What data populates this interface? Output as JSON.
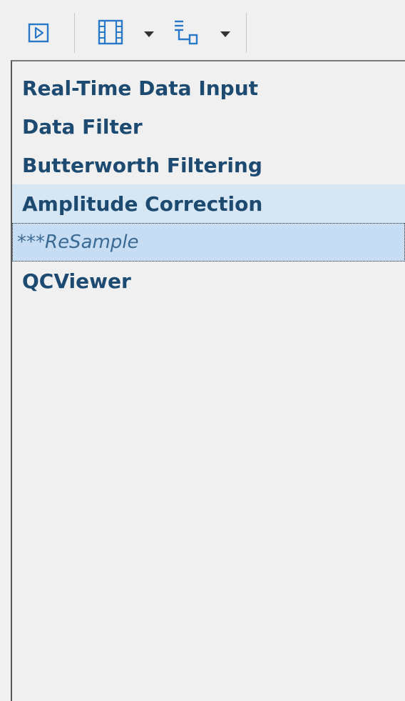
{
  "toolbar": {
    "buttons": [
      {
        "icon": "play-icon",
        "color": "#2a78c8"
      },
      {
        "icon": "film-strip-icon",
        "color": "#2a78c8"
      },
      {
        "icon": "dropdown-arrow-icon",
        "color": "#333333"
      },
      {
        "icon": "tree-structure-icon",
        "color": "#2a78c8"
      },
      {
        "icon": "dropdown-arrow-icon",
        "color": "#333333"
      }
    ]
  },
  "flow": {
    "items": [
      {
        "label": "Real-Time Data Input",
        "state": "normal"
      },
      {
        "label": "Data Filter",
        "state": "normal"
      },
      {
        "label": "Butterworth Filtering",
        "state": "normal"
      },
      {
        "label": "Amplitude Correction",
        "state": "highlighted"
      },
      {
        "label": "***ReSample",
        "state": "selected"
      },
      {
        "label": "QCViewer",
        "state": "normal"
      }
    ]
  },
  "colors": {
    "background": "#f0f0f0",
    "item_text": "#1d4a70",
    "selected_text": "#3b6b94",
    "highlight_bg": "#d7e6f3",
    "selected_bg": "#c7ddf3",
    "icon_blue": "#2a78c8"
  }
}
